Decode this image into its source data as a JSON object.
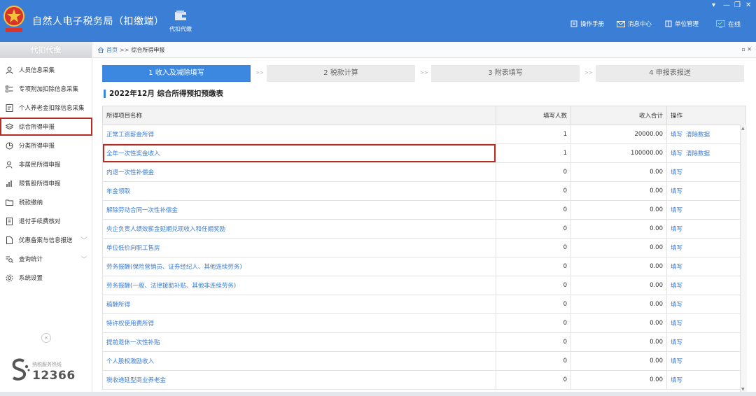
{
  "app": {
    "title": "自然人电子税务局（扣缴端）",
    "module_label": "代扣代缴",
    "header_links": [
      {
        "label": "操作手册",
        "icon": "manual-icon"
      },
      {
        "label": "消息中心",
        "icon": "mail-icon"
      },
      {
        "label": "单位管理",
        "icon": "building-icon"
      },
      {
        "label": "在线",
        "icon": "online-monitor-icon"
      }
    ],
    "window_controls": [
      "▾",
      "—",
      "❐",
      "✕"
    ]
  },
  "sidebar": {
    "header": "代扣代缴",
    "items": [
      {
        "label": "人员信息采集",
        "icon": "person-icon"
      },
      {
        "label": "专项附加扣除信息采集",
        "icon": "list-icon"
      },
      {
        "label": "个人养老金扣除信息采集",
        "icon": "document-icon"
      },
      {
        "label": "综合所得申报",
        "icon": "layers-icon",
        "active": true
      },
      {
        "label": "分类所得申报",
        "icon": "pie-chart-icon"
      },
      {
        "label": "非居民所得申报",
        "icon": "person-outline-icon"
      },
      {
        "label": "限售股所得申报",
        "icon": "bar-chart-icon"
      },
      {
        "label": "税款缴纳",
        "icon": "folder-icon"
      },
      {
        "label": "退付手续费核对",
        "icon": "receipt-icon"
      },
      {
        "label": "优惠备案与信息报送",
        "icon": "file-icon",
        "expandable": true
      },
      {
        "label": "查询统计",
        "icon": "search-list-icon",
        "expandable": true
      },
      {
        "label": "系统设置",
        "icon": "gear-icon"
      }
    ],
    "collapse_glyph": "«",
    "hotline_label": "纳税服务热线",
    "hotline_number": "12366"
  },
  "breadcrumb": {
    "home": "首页",
    "separator": ">>",
    "current": "综合所得申报"
  },
  "steps": [
    {
      "label": "1 收入及减除填写",
      "active": true
    },
    {
      "label": "2 税款计算",
      "active": false
    },
    {
      "label": "3 附表填写",
      "active": false
    },
    {
      "label": "4 申报表报送",
      "active": false
    }
  ],
  "step_separator": ">>",
  "table": {
    "title": "2022年12月  综合所得预扣预缴表",
    "columns": [
      "所得项目名称",
      "填写人数",
      "收入合计",
      "操作"
    ],
    "rows": [
      {
        "name": "正常工资薪金所得",
        "count": "1",
        "income": "20000.00",
        "ops": [
          "填写",
          "清除数据"
        ]
      },
      {
        "name": "全年一次性奖金收入",
        "count": "1",
        "income": "100000.00",
        "ops": [
          "填写",
          "清除数据"
        ],
        "highlighted": true
      },
      {
        "name": "内退一次性补偿金",
        "count": "0",
        "income": "0.00",
        "ops": [
          "填写"
        ]
      },
      {
        "name": "年金领取",
        "count": "0",
        "income": "0.00",
        "ops": [
          "填写"
        ]
      },
      {
        "name": "解除劳动合同一次性补偿金",
        "count": "0",
        "income": "0.00",
        "ops": [
          "填写"
        ]
      },
      {
        "name": "央企负责人绩效薪金延期兑现收入和任期奖励",
        "count": "0",
        "income": "0.00",
        "ops": [
          "填写"
        ]
      },
      {
        "name": "单位低价向职工售房",
        "count": "0",
        "income": "0.00",
        "ops": [
          "填写"
        ]
      },
      {
        "name": "劳务报酬(保险营销员、证券经纪人、其他连续劳务)",
        "count": "0",
        "income": "0.00",
        "ops": [
          "填写"
        ]
      },
      {
        "name": "劳务报酬(一般、法律援助补贴、其他非连续劳务)",
        "count": "0",
        "income": "0.00",
        "ops": [
          "填写"
        ]
      },
      {
        "name": "稿酬所得",
        "count": "0",
        "income": "0.00",
        "ops": [
          "填写"
        ]
      },
      {
        "name": "特许权使用费所得",
        "count": "0",
        "income": "0.00",
        "ops": [
          "填写"
        ]
      },
      {
        "name": "提前退休一次性补贴",
        "count": "0",
        "income": "0.00",
        "ops": [
          "填写"
        ]
      },
      {
        "name": "个人股权激励收入",
        "count": "0",
        "income": "0.00",
        "ops": [
          "填写"
        ]
      },
      {
        "name": "税收递延型商业养老金",
        "count": "0",
        "income": "0.00",
        "ops": [
          "填写"
        ]
      }
    ]
  },
  "colors": {
    "header_blue": "#3b7ed6",
    "active_step": "#3c87e0",
    "link_blue": "#3a7bd5",
    "highlight_red": "#b72d24"
  }
}
